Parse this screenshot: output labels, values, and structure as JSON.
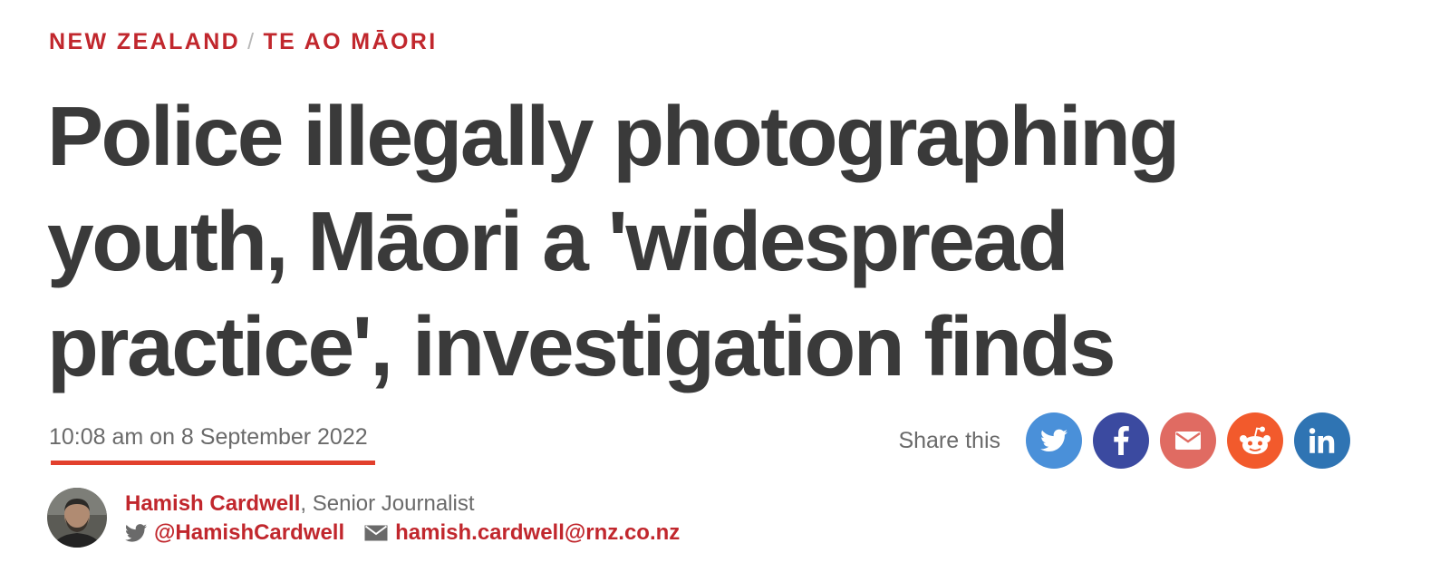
{
  "breadcrumb": {
    "section": "NEW ZEALAND",
    "separator": "/",
    "subsection": "TE AO MĀORI"
  },
  "headline": {
    "line1": "Police illegally photographing",
    "line2": "youth, Māori a 'widespread",
    "line3": "practice', investigation finds"
  },
  "dateline": "10:08 am on 8 September 2022",
  "share": {
    "label": "Share this",
    "buttons": [
      {
        "icon": "twitter-icon",
        "color": "#4a90d9"
      },
      {
        "icon": "facebook-icon",
        "color": "#3b4aa0"
      },
      {
        "icon": "email-icon",
        "color": "#e06b62"
      },
      {
        "icon": "reddit-icon",
        "color": "#f25a2c"
      },
      {
        "icon": "linkedin-icon",
        "color": "#2f74b3"
      }
    ]
  },
  "author": {
    "name": "Hamish Cardwell",
    "role": ", Senior Journalist",
    "twitter": "@HamishCardwell",
    "email": "hamish.cardwell@rnz.co.nz"
  },
  "colors": {
    "accent": "#c1272d",
    "underline": "#e2402d",
    "headline": "#3a3a3a",
    "meta": "#6a6a6a"
  }
}
